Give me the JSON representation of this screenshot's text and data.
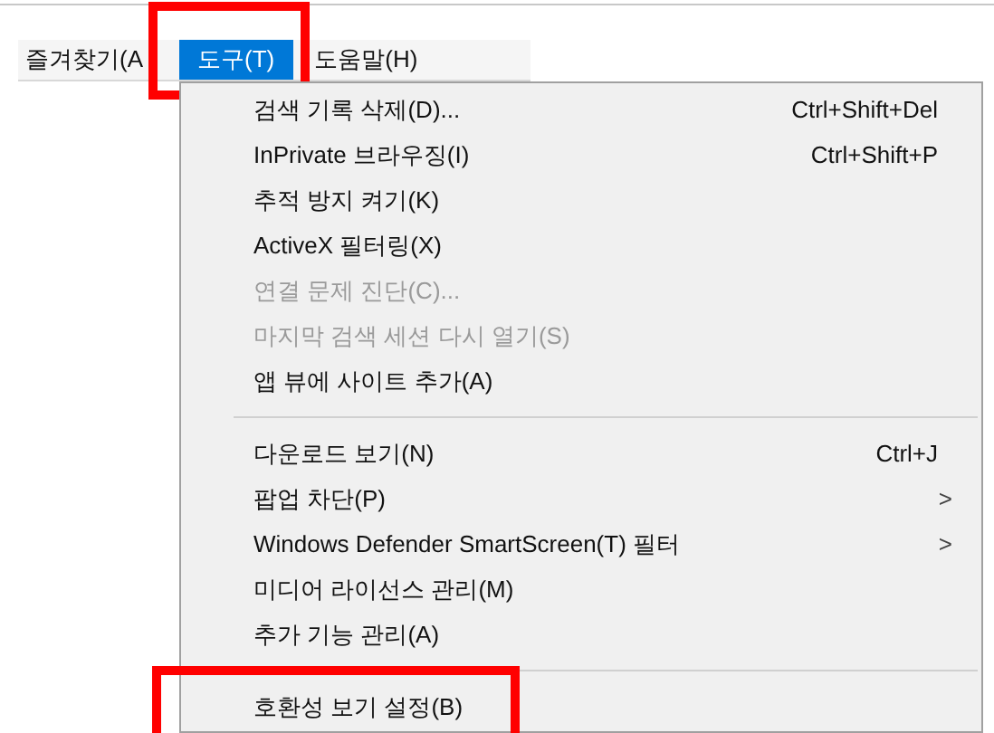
{
  "menu_bar": [
    {
      "label": "즐겨찾기(A",
      "selected": false,
      "highlighted": false
    },
    {
      "label": "도구(T)",
      "selected": true,
      "highlighted": true
    },
    {
      "label": "도움말(H)",
      "selected": false,
      "highlighted": false
    }
  ],
  "menu": [
    {
      "kind": "item",
      "label": "검색 기록 삭제(D)...",
      "shortcut": "Ctrl+Shift+Del",
      "disabled": false,
      "highlighted": false
    },
    {
      "kind": "item",
      "label": "InPrivate 브라우징(I)",
      "shortcut": "Ctrl+Shift+P",
      "disabled": false,
      "highlighted": false
    },
    {
      "kind": "item",
      "label": "추적 방지 켜기(K)",
      "disabled": false,
      "highlighted": false
    },
    {
      "kind": "item",
      "label": "ActiveX 필터링(X)",
      "disabled": false,
      "highlighted": false
    },
    {
      "kind": "item",
      "label": "연결 문제 진단(C)...",
      "disabled": true,
      "highlighted": false
    },
    {
      "kind": "item",
      "label": "마지막 검색 세션 다시 열기(S)",
      "disabled": true,
      "highlighted": false
    },
    {
      "kind": "item",
      "label": "앱 뷰에 사이트 추가(A)",
      "disabled": false,
      "highlighted": false
    },
    {
      "kind": "separator"
    },
    {
      "kind": "item",
      "label": "다운로드 보기(N)",
      "shortcut": "Ctrl+J",
      "disabled": false,
      "highlighted": false
    },
    {
      "kind": "submenu",
      "label": "팝업 차단(P)",
      "arrow": ">",
      "disabled": false,
      "highlighted": false
    },
    {
      "kind": "submenu",
      "label": "Windows Defender SmartScreen(T) 필터",
      "arrow": ">",
      "disabled": false,
      "highlighted": false
    },
    {
      "kind": "item",
      "label": "미디어 라이선스 관리(M)",
      "disabled": false,
      "highlighted": false
    },
    {
      "kind": "item",
      "label": "추가 기능 관리(A)",
      "disabled": false,
      "highlighted": false
    },
    {
      "kind": "separator"
    },
    {
      "kind": "item",
      "label": "호환성 보기 설정(B)",
      "disabled": false,
      "highlighted": true
    }
  ]
}
